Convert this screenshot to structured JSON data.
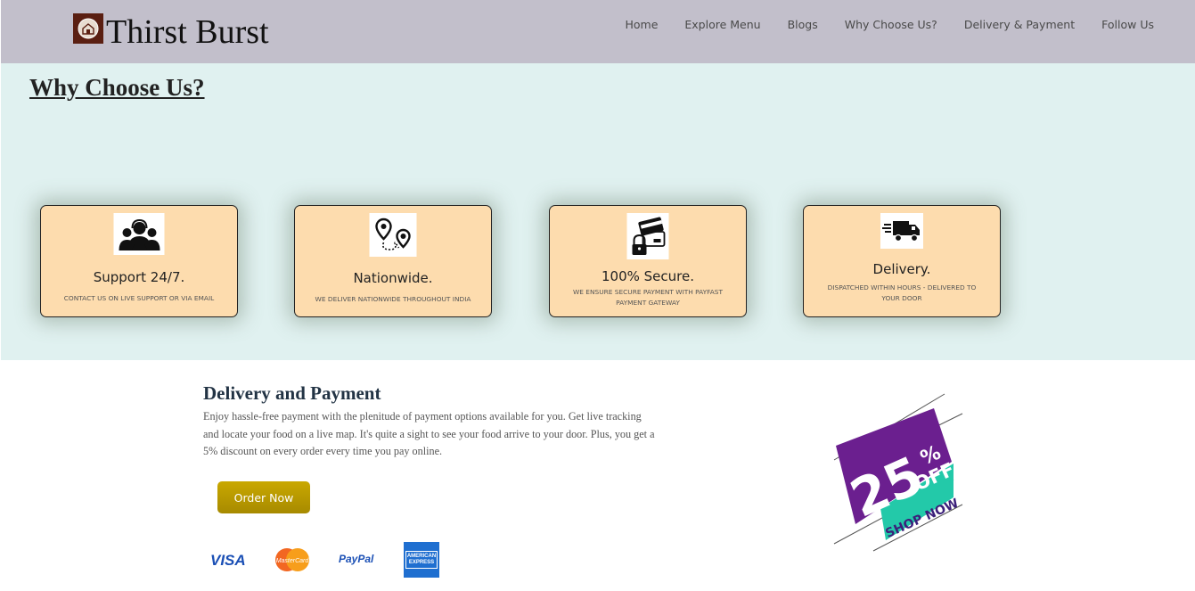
{
  "header": {
    "brand": "Thirst Burst",
    "nav": [
      "Home",
      "Explore Menu",
      "Blogs",
      "Why Choose Us?",
      "Delivery & Payment",
      "Follow Us"
    ]
  },
  "why": {
    "title": "Why Choose Us?",
    "cards": [
      {
        "icon": "support-team-icon",
        "title": "Support 24/7.",
        "subtitle": "CONTACT US ON LIVE SUPPORT OR VIA EMAIL"
      },
      {
        "icon": "map-route-icon",
        "title": "Nationwide.",
        "subtitle": "WE DELIVER NATIONWIDE THROUGHOUT INDIA"
      },
      {
        "icon": "secure-card-icon",
        "title": "100% Secure.",
        "subtitle": "WE ENSURE SECURE PAYMENT WITH PAYFAST PAYMENT GATEWAY"
      },
      {
        "icon": "delivery-truck-icon",
        "title": "Delivery.",
        "subtitle": "DISPATCHED WITHIN HOURS - DELIVERED TO YOUR DOOR"
      }
    ]
  },
  "delivery": {
    "title": "Delivery and Payment",
    "text": "Enjoy hassle-free payment with the plenitude of payment options available for you. Get live tracking and locate your food on a live map. It's quite a sight to see your food arrive to your door. Plus, you get a 5% discount on every order every time you pay online.",
    "button": "Order Now",
    "payments": {
      "visa": "VISA",
      "mastercard": "MasterCard",
      "paypal": "PayPal",
      "amex_line1": "AMERICAN",
      "amex_line2": "EXPRESS"
    }
  },
  "promo": {
    "percent": "25",
    "pct_sign": "%",
    "off": "OFF",
    "cta": "SHOP NOW"
  },
  "colors": {
    "navbar": "#c2bfcb",
    "section_bg": "#e0f1f0",
    "card_bg": "#fddcae",
    "button": "#b89800",
    "promo_purple": "#6b1f8f",
    "promo_teal": "#23c9a9"
  }
}
